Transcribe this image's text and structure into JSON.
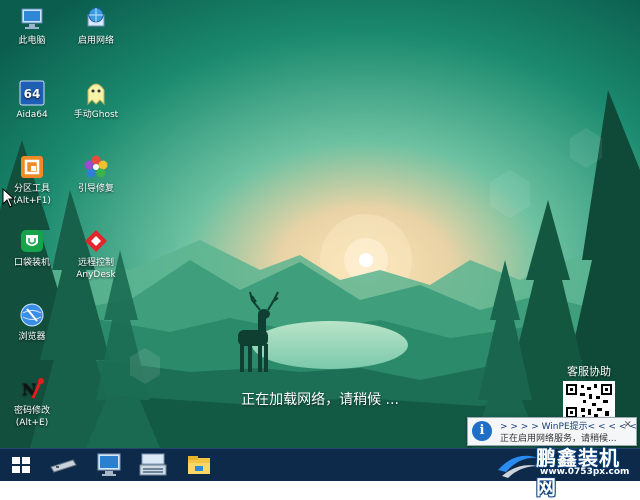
{
  "desktop_icons": [
    {
      "name": "此电脑",
      "icon": "computer-icon"
    },
    {
      "name": "启用网络",
      "icon": "network-globe-icon"
    },
    {
      "name": "Aida64",
      "icon": "aida64-icon"
    },
    {
      "name": "手动Ghost",
      "icon": "ghost-icon"
    },
    {
      "name": "分区工具\n(Alt+F1)",
      "icon": "partition-tool-icon"
    },
    {
      "name": "引导修复",
      "icon": "boot-repair-icon"
    },
    {
      "name": "口袋装机",
      "icon": "pocket-install-icon"
    },
    {
      "name": "远程控制\nAnyDesk",
      "icon": "anydesk-icon"
    },
    {
      "name": "浏览器",
      "icon": "browser-icon"
    },
    {
      "name": "密码修改\n(Alt+E)",
      "icon": "password-tool-icon"
    }
  ],
  "aida_badge": "64",
  "loading_text": "正在加载网络，请稍候 ...",
  "support_label": "客服协助",
  "popup": {
    "title": "> > > > WinPE提示< < < < <",
    "body": "正在启用网络服务，请稍候...",
    "close": "×",
    "icon_letter": "i"
  },
  "taskbar_items": [
    "start-icon",
    "drive-icon",
    "computer-monitor-icon",
    "keyboard-icon",
    "file-explorer-icon"
  ],
  "watermark": {
    "title": "鹏鑫装机网",
    "url": "www.0753px.com"
  },
  "colors": {
    "taskbar": "#0e2a4a",
    "sky_top": "#0d6b5a",
    "sky_glow": "#f3d3a0",
    "tree": "#0f4d3a"
  }
}
